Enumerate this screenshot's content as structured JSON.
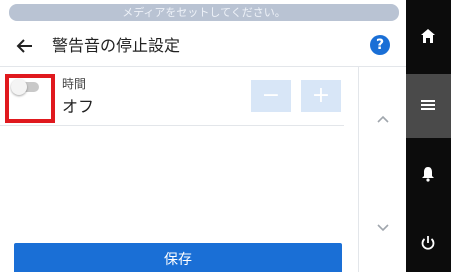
{
  "notice": "メディアをセットしてください。",
  "header": {
    "title": "警告音の停止設定",
    "help_label": "?"
  },
  "setting": {
    "label": "時間",
    "value": "オフ",
    "toggle_state": "off",
    "minus_label": "−",
    "plus_label": "+"
  },
  "footer": {
    "save_label": "保存"
  },
  "colors": {
    "accent": "#1a6fd6",
    "highlight": "#e0191e",
    "nav_bg": "#0c0c0c",
    "nav_active": "#4a4a4a"
  },
  "icons": [
    "back-arrow-icon",
    "help-icon",
    "chevron-up-icon",
    "chevron-down-icon",
    "home-icon",
    "menu-icon",
    "bell-icon",
    "power-icon"
  ]
}
